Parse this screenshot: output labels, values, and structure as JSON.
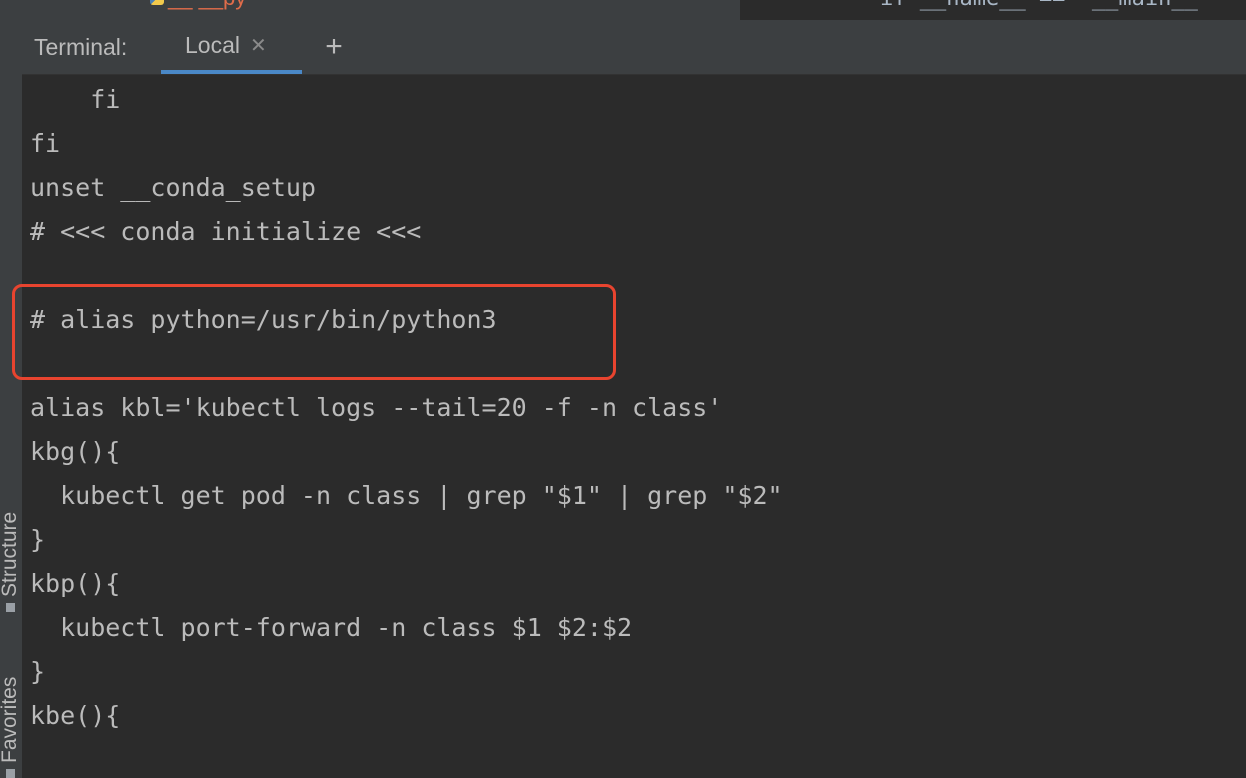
{
  "sidebar": {
    "structure_label": "Structure",
    "favorites_label": "Favorites"
  },
  "editor": {
    "file_tab_label": "__ __py",
    "code_line": "if __name__ == '__main__'"
  },
  "terminal": {
    "title": "Terminal:",
    "tab_label": "Local",
    "add_tab_label": "+",
    "lines": [
      "    fi",
      "fi",
      "unset __conda_setup",
      "# <<< conda initialize <<<",
      "",
      "# alias python=/usr/bin/python3",
      "",
      "alias kbl='kubectl logs --tail=20 -f -n class'",
      "kbg(){",
      "  kubectl get pod -n class | grep \"$1\" | grep \"$2\"",
      "}",
      "kbp(){",
      "  kubectl port-forward -n class $1 $2:$2",
      "}",
      "kbe(){"
    ]
  },
  "colors": {
    "background": "#2b2b2b",
    "header": "#3c3f41",
    "text": "#bbbbbb",
    "active_tab_underline": "#4a88c7",
    "highlight_box": "#e8442f"
  }
}
